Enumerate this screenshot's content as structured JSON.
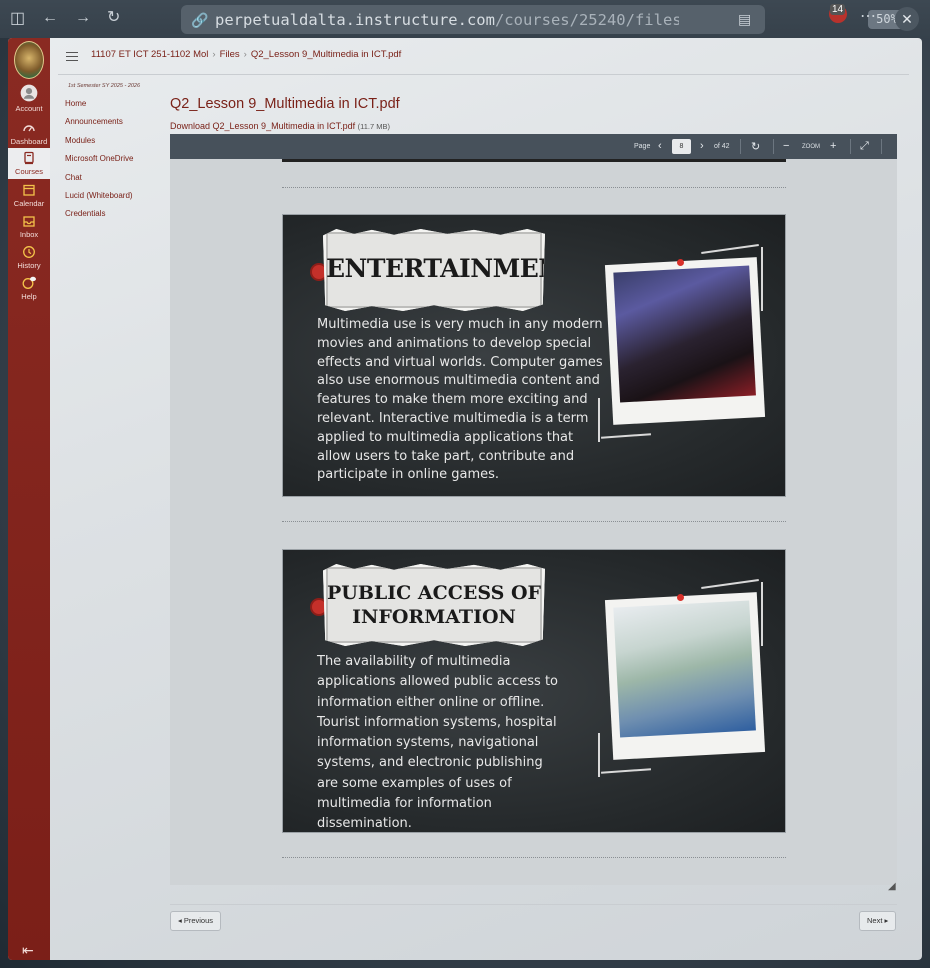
{
  "browser": {
    "url_main": "perpetualdalta.instructure.com",
    "url_path": "/courses/25240/files",
    "zoom": "50%",
    "extension_count": "14"
  },
  "global_nav": {
    "items": [
      {
        "label": "Account"
      },
      {
        "label": "Dashboard"
      },
      {
        "label": "Courses"
      },
      {
        "label": "Calendar"
      },
      {
        "label": "Inbox"
      },
      {
        "label": "History"
      },
      {
        "label": "Help"
      }
    ]
  },
  "breadcrumb": {
    "course": "11107 ET ICT 251-1102 Mol",
    "files": "Files",
    "file": "Q2_Lesson 9_Multimedia in ICT.pdf"
  },
  "course_nav": {
    "term": "1st Semester SY 2025 - 2026",
    "items": [
      {
        "label": "Home"
      },
      {
        "label": "Announcements"
      },
      {
        "label": "Modules"
      },
      {
        "label": "Microsoft OneDrive"
      },
      {
        "label": "Chat"
      },
      {
        "label": "Lucid (Whiteboard)"
      },
      {
        "label": "Credentials"
      }
    ]
  },
  "file": {
    "title": "Q2_Lesson 9_Multimedia in ICT.pdf",
    "download_label": "Download Q2_Lesson 9_Multimedia in ICT.pdf",
    "size": "(11.7 MB)"
  },
  "viewer": {
    "page_label": "Page",
    "page_value": "8",
    "page_total": "of 42",
    "zoom_label": "ZOOM"
  },
  "slides": [
    {
      "title": "ENTERTAINMENT",
      "body": "Multimedia use is very much in any modern movies and animations to develop special effects and virtual worlds. Computer games also use enormous multimedia content and features to make them more exciting and relevant. Interactive multimedia is a term applied to multimedia applications that allow users to take part, contribute and participate in online games."
    },
    {
      "title_line1": "PUBLIC ACCESS OF",
      "title_line2": "INFORMATION",
      "body": "The availability of multimedia applications allowed public access to information either online or offline. Tourist information systems, hospital information systems, navigational systems, and electronic publishing are some examples of uses of multimedia for information dissemination."
    }
  ],
  "pagination": {
    "previous": "◂ Previous",
    "next": "Next ▸"
  },
  "colors": {
    "canvas_red": "#8a2a22",
    "link": "#7a2219",
    "toolbar": "#47515b"
  }
}
